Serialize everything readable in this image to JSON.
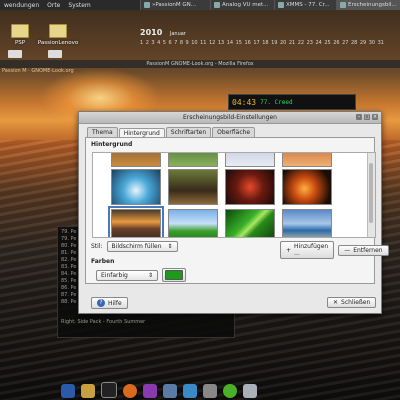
{
  "topbar": {
    "menus": [
      "wendungen",
      "Orte",
      "System"
    ],
    "tasks": [
      "»PassionM GN...",
      "Analog VU met...",
      "XMMS - 77. Cr...",
      "Erscheinungsbil..."
    ]
  },
  "desktop": {
    "icons": [
      {
        "label": "PSP"
      },
      {
        "label": "PassionLenovo"
      }
    ]
  },
  "calendar": {
    "year": "2010",
    "month": "Januar",
    "days": [
      "1",
      "2",
      "3",
      "4",
      "5",
      "6",
      "7",
      "8",
      "9",
      "10",
      "11",
      "12",
      "13",
      "14",
      "15",
      "16",
      "17",
      "18",
      "19",
      "20",
      "21",
      "22",
      "23",
      "24",
      "25",
      "26",
      "27",
      "28",
      "29",
      "30",
      "31"
    ]
  },
  "firefox": {
    "title": "PassionM GNOME-Look.org - Mozilla Firefox",
    "side_text": "Passion M · GNOME-Look.org"
  },
  "xmms": {
    "time": "04:43",
    "label": "77. Creed"
  },
  "playlist": {
    "rows": [
      "79. Pe",
      "79. Pe",
      "80. Pe",
      "81. Pe",
      "82. Pe",
      "83. Pe",
      "84. Pe",
      "85. Pe",
      "86. Pe",
      "87. Pe",
      "88. Pe"
    ],
    "footer": "Right: Side Pack - Fourth Summer"
  },
  "dialog": {
    "title": "Erscheinungsbild-Einstellungen",
    "tabs": [
      "Thema",
      "Hintergrund",
      "Schriftarten",
      "Oberfläche"
    ],
    "active_tab": "Hintergrund",
    "background_section": "Hintergrund",
    "style_label": "Stil:",
    "style_value": "Bildschirm füllen",
    "add_button": "Hinzufügen ...",
    "remove_button": "Entfernen",
    "colors_section": "Farben",
    "color_mode": "Einfarbig",
    "color_hex": "#1d9a1a",
    "help_button": "Hilfe",
    "close_button": "Schließen"
  },
  "dock": {
    "icons": [
      "home-icon",
      "files-icon",
      "terminal-icon",
      "firefox-icon",
      "music-icon",
      "camera-icon",
      "image-icon",
      "settings-icon",
      "chat-icon",
      "trash-icon"
    ]
  }
}
